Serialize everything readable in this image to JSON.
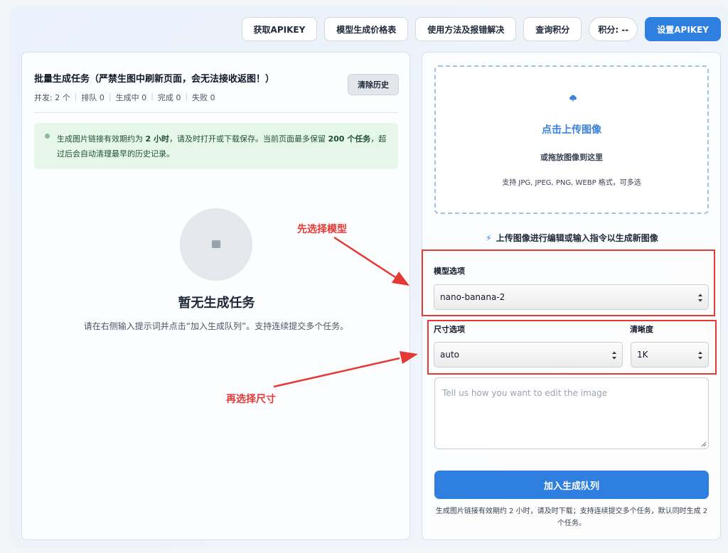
{
  "toolbar": {
    "get_apikey": "获取APIKEY",
    "pricing": "模型生成价格表",
    "usage": "使用方法及报错解决",
    "query_credits": "查询积分",
    "credits": "积分: --",
    "set_apikey": "设置APIKEY"
  },
  "left": {
    "title": "批量生成任务（严禁生图中刷新页面，会无法接收返图！）",
    "stats": {
      "concurrency": "并发: 2 个",
      "queued": "排队 0",
      "generating": "生成中 0",
      "done": "完成 0",
      "failed": "失败 0"
    },
    "clear_button": "清除历史",
    "notice": {
      "t1": "生成图片链接有效期约为 ",
      "b1": "2 小时",
      "t2": "，请及时打开或下载保存。当前页面最多保留 ",
      "b2": "200 个任务",
      "t3": "，超过后会自动清理最早的历史记录。"
    },
    "empty_title": "暂无生成任务",
    "empty_desc": "请在右侧输入提示词并点击“加入生成队列”。支持连续提交多个任务。"
  },
  "annotations": {
    "model_first": "先选择模型",
    "size_then": "再选择尺寸"
  },
  "right": {
    "upload_title": "点击上传图像",
    "upload_sub": "或拖放图像到这里",
    "upload_hint": "支持 JPG, JPEG, PNG, WEBP 格式，可多选",
    "hint": "上传图像进行编辑或输入指令以生成新图像",
    "model_label": "模型选项",
    "model_value": "nano-banana-2",
    "size_label": "尺寸选项",
    "size_value": "auto",
    "clarity_label": "清晰度",
    "clarity_value": "1K",
    "prompt_placeholder": "Tell us how you want to edit the image",
    "submit": "加入生成队列",
    "footer": "生成图片链接有效期约 2 小时，请及时下载；支持连续提交多个任务，默认同时生成 2 个任务。"
  },
  "colors": {
    "primary": "#2f7fe0",
    "annotation": "#e53935",
    "notice_bg": "#e6f7ea"
  }
}
